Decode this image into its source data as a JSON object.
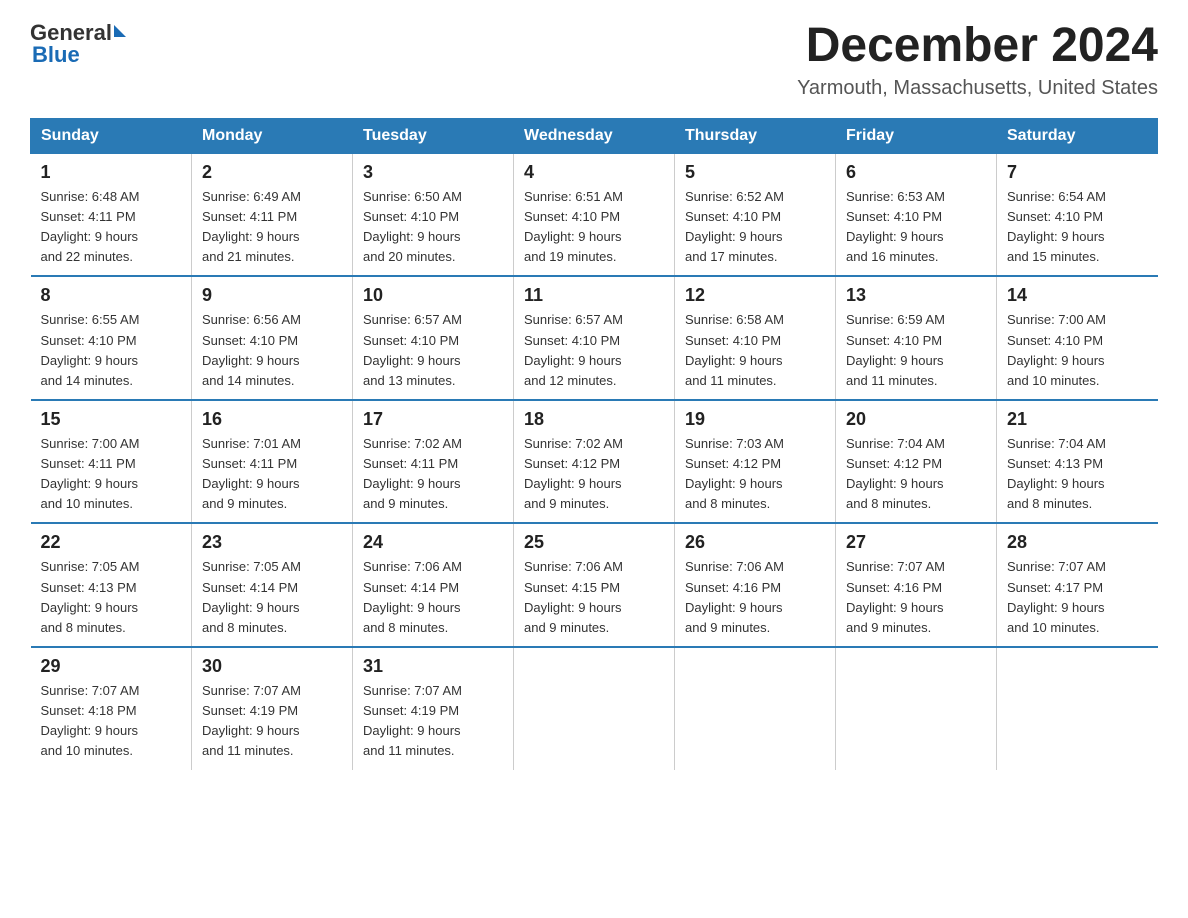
{
  "header": {
    "logo_general": "General",
    "logo_blue": "Blue",
    "month_year": "December 2024",
    "location": "Yarmouth, Massachusetts, United States"
  },
  "days_of_week": [
    "Sunday",
    "Monday",
    "Tuesday",
    "Wednesday",
    "Thursday",
    "Friday",
    "Saturday"
  ],
  "weeks": [
    [
      {
        "day": "1",
        "sunrise": "6:48 AM",
        "sunset": "4:11 PM",
        "daylight": "9 hours and 22 minutes."
      },
      {
        "day": "2",
        "sunrise": "6:49 AM",
        "sunset": "4:11 PM",
        "daylight": "9 hours and 21 minutes."
      },
      {
        "day": "3",
        "sunrise": "6:50 AM",
        "sunset": "4:10 PM",
        "daylight": "9 hours and 20 minutes."
      },
      {
        "day": "4",
        "sunrise": "6:51 AM",
        "sunset": "4:10 PM",
        "daylight": "9 hours and 19 minutes."
      },
      {
        "day": "5",
        "sunrise": "6:52 AM",
        "sunset": "4:10 PM",
        "daylight": "9 hours and 17 minutes."
      },
      {
        "day": "6",
        "sunrise": "6:53 AM",
        "sunset": "4:10 PM",
        "daylight": "9 hours and 16 minutes."
      },
      {
        "day": "7",
        "sunrise": "6:54 AM",
        "sunset": "4:10 PM",
        "daylight": "9 hours and 15 minutes."
      }
    ],
    [
      {
        "day": "8",
        "sunrise": "6:55 AM",
        "sunset": "4:10 PM",
        "daylight": "9 hours and 14 minutes."
      },
      {
        "day": "9",
        "sunrise": "6:56 AM",
        "sunset": "4:10 PM",
        "daylight": "9 hours and 14 minutes."
      },
      {
        "day": "10",
        "sunrise": "6:57 AM",
        "sunset": "4:10 PM",
        "daylight": "9 hours and 13 minutes."
      },
      {
        "day": "11",
        "sunrise": "6:57 AM",
        "sunset": "4:10 PM",
        "daylight": "9 hours and 12 minutes."
      },
      {
        "day": "12",
        "sunrise": "6:58 AM",
        "sunset": "4:10 PM",
        "daylight": "9 hours and 11 minutes."
      },
      {
        "day": "13",
        "sunrise": "6:59 AM",
        "sunset": "4:10 PM",
        "daylight": "9 hours and 11 minutes."
      },
      {
        "day": "14",
        "sunrise": "7:00 AM",
        "sunset": "4:10 PM",
        "daylight": "9 hours and 10 minutes."
      }
    ],
    [
      {
        "day": "15",
        "sunrise": "7:00 AM",
        "sunset": "4:11 PM",
        "daylight": "9 hours and 10 minutes."
      },
      {
        "day": "16",
        "sunrise": "7:01 AM",
        "sunset": "4:11 PM",
        "daylight": "9 hours and 9 minutes."
      },
      {
        "day": "17",
        "sunrise": "7:02 AM",
        "sunset": "4:11 PM",
        "daylight": "9 hours and 9 minutes."
      },
      {
        "day": "18",
        "sunrise": "7:02 AM",
        "sunset": "4:12 PM",
        "daylight": "9 hours and 9 minutes."
      },
      {
        "day": "19",
        "sunrise": "7:03 AM",
        "sunset": "4:12 PM",
        "daylight": "9 hours and 8 minutes."
      },
      {
        "day": "20",
        "sunrise": "7:04 AM",
        "sunset": "4:12 PM",
        "daylight": "9 hours and 8 minutes."
      },
      {
        "day": "21",
        "sunrise": "7:04 AM",
        "sunset": "4:13 PM",
        "daylight": "9 hours and 8 minutes."
      }
    ],
    [
      {
        "day": "22",
        "sunrise": "7:05 AM",
        "sunset": "4:13 PM",
        "daylight": "9 hours and 8 minutes."
      },
      {
        "day": "23",
        "sunrise": "7:05 AM",
        "sunset": "4:14 PM",
        "daylight": "9 hours and 8 minutes."
      },
      {
        "day": "24",
        "sunrise": "7:06 AM",
        "sunset": "4:14 PM",
        "daylight": "9 hours and 8 minutes."
      },
      {
        "day": "25",
        "sunrise": "7:06 AM",
        "sunset": "4:15 PM",
        "daylight": "9 hours and 9 minutes."
      },
      {
        "day": "26",
        "sunrise": "7:06 AM",
        "sunset": "4:16 PM",
        "daylight": "9 hours and 9 minutes."
      },
      {
        "day": "27",
        "sunrise": "7:07 AM",
        "sunset": "4:16 PM",
        "daylight": "9 hours and 9 minutes."
      },
      {
        "day": "28",
        "sunrise": "7:07 AM",
        "sunset": "4:17 PM",
        "daylight": "9 hours and 10 minutes."
      }
    ],
    [
      {
        "day": "29",
        "sunrise": "7:07 AM",
        "sunset": "4:18 PM",
        "daylight": "9 hours and 10 minutes."
      },
      {
        "day": "30",
        "sunrise": "7:07 AM",
        "sunset": "4:19 PM",
        "daylight": "9 hours and 11 minutes."
      },
      {
        "day": "31",
        "sunrise": "7:07 AM",
        "sunset": "4:19 PM",
        "daylight": "9 hours and 11 minutes."
      },
      null,
      null,
      null,
      null
    ]
  ],
  "labels": {
    "sunrise": "Sunrise:",
    "sunset": "Sunset:",
    "daylight": "Daylight:"
  }
}
